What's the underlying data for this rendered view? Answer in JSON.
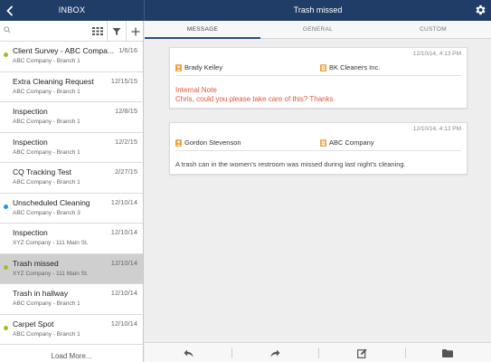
{
  "header": {
    "inbox_title": "INBOX",
    "detail_title": "Trash missed",
    "back_icon": "chevron-left-icon",
    "settings_icon": "gear-icon"
  },
  "search": {
    "placeholder": ""
  },
  "toolbar": {
    "icons": [
      "grid-view-icon",
      "filter-icon",
      "add-icon"
    ]
  },
  "inbox": {
    "items": [
      {
        "title": "Client Survey - ABC Compa...",
        "date": "1/6/16",
        "subtitle": "ABC Company - Branch 1",
        "dot": "#9cbf2a"
      },
      {
        "title": "Extra Cleaning Request",
        "date": "12/15/15",
        "subtitle": "ABC Company - Branch 1",
        "dot": ""
      },
      {
        "title": "Inspection",
        "date": "12/8/15",
        "subtitle": "ABC Company - Branch 1",
        "dot": ""
      },
      {
        "title": "Inspection",
        "date": "12/2/15",
        "subtitle": "ABC Company - Branch 1",
        "dot": ""
      },
      {
        "title": "CQ Tracking Test",
        "date": "2/27/15",
        "subtitle": "ABC Company - Branch 1",
        "dot": ""
      },
      {
        "title": "Unscheduled Cleaning",
        "date": "12/10/14",
        "subtitle": "ABC Company - Branch 3",
        "dot": "#1f9bd6"
      },
      {
        "title": "Inspection",
        "date": "12/10/14",
        "subtitle": "XYZ Company - 111 Main St.",
        "dot": ""
      },
      {
        "title": "Trash missed",
        "date": "12/10/14",
        "subtitle": "XYZ Company - 111 Main St.",
        "dot": "#9cbf2a"
      },
      {
        "title": "Trash in hallway",
        "date": "12/10/14",
        "subtitle": "ABC Company - Branch 1",
        "dot": ""
      },
      {
        "title": "Carpet Spot",
        "date": "12/10/14",
        "subtitle": "ABC Company - Branch 1",
        "dot": "#9cbf2a"
      }
    ],
    "load_more": "Load More..."
  },
  "tabs": [
    "MESSAGE",
    "GENERAL",
    "CUSTOM"
  ],
  "messages": [
    {
      "timestamp": "12/10/14, 4:13 PM",
      "person": "Brady Kelley",
      "company": "BK Cleaners Inc.",
      "note_label": "Internal Note",
      "body": "Chris, could you please take care of this? Thanks"
    },
    {
      "timestamp": "12/10/14, 4:12 PM",
      "person": "Gordon Stevenson",
      "company": "ABC Company",
      "body": "A trash can in the women's restroom was missed during last night's cleaning."
    }
  ],
  "bottom_actions": [
    "reply-icon",
    "forward-icon",
    "edit-icon",
    "folder-icon"
  ],
  "colors": {
    "header_bg": "#1f3d66",
    "accent_orange": "#e2553b",
    "dot_green": "#9cbf2a",
    "dot_blue": "#1f9bd6",
    "selected_row": "#cfcfcf"
  }
}
